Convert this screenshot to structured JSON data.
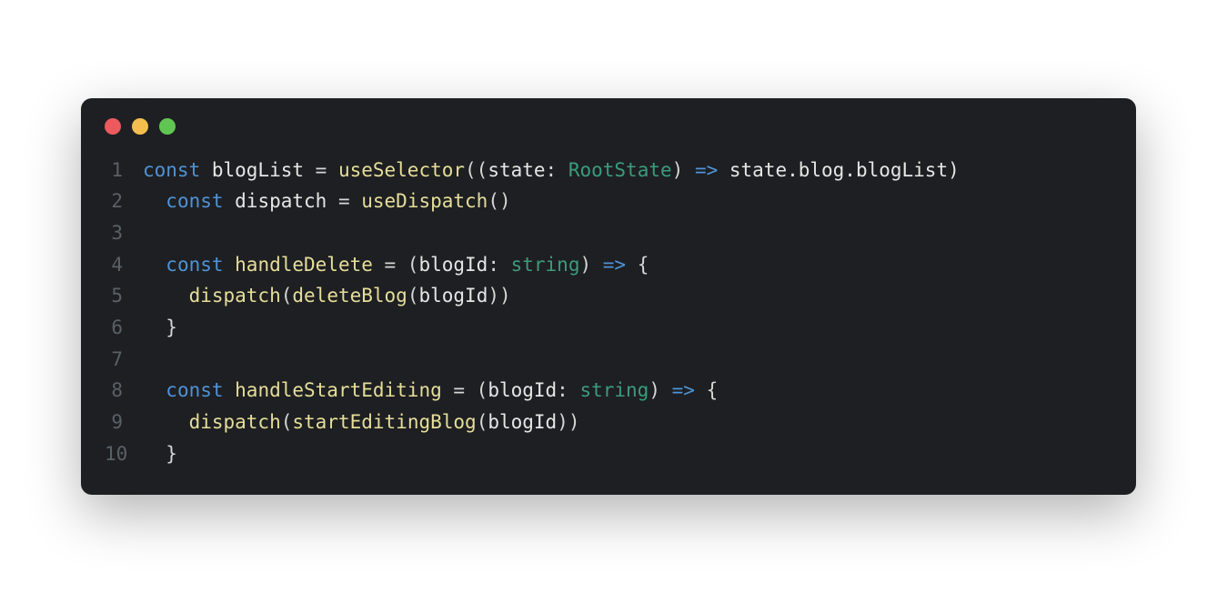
{
  "window": {
    "traffic_lights": {
      "close_color": "#ec5a5e",
      "min_color": "#f4be4f",
      "max_color": "#61c554"
    }
  },
  "colors": {
    "bg": "#1e1f22",
    "keyword": "#4f93d6",
    "function": "#e5de9a",
    "type": "#3a9c7b",
    "text": "#d8dde3",
    "gutter": "#5a6068"
  },
  "code": {
    "line_numbers": [
      "1",
      "2",
      "3",
      "4",
      "5",
      "6",
      "7",
      "8",
      "9",
      "10"
    ],
    "lines": [
      [
        {
          "t": "const ",
          "c": "kw"
        },
        {
          "t": "blogList",
          "c": "var"
        },
        {
          "t": " = ",
          "c": "punc"
        },
        {
          "t": "useSelector",
          "c": "fn"
        },
        {
          "t": "((",
          "c": "punc"
        },
        {
          "t": "state",
          "c": "var"
        },
        {
          "t": ": ",
          "c": "punc"
        },
        {
          "t": "RootState",
          "c": "type"
        },
        {
          "t": ") ",
          "c": "punc"
        },
        {
          "t": "=>",
          "c": "op"
        },
        {
          "t": " state.blog.blogList)",
          "c": "var"
        }
      ],
      [
        {
          "t": "  ",
          "c": "punc"
        },
        {
          "t": "const ",
          "c": "kw"
        },
        {
          "t": "dispatch",
          "c": "var"
        },
        {
          "t": " = ",
          "c": "punc"
        },
        {
          "t": "useDispatch",
          "c": "fn"
        },
        {
          "t": "()",
          "c": "punc"
        }
      ],
      [
        {
          "t": "",
          "c": "punc"
        }
      ],
      [
        {
          "t": "  ",
          "c": "punc"
        },
        {
          "t": "const ",
          "c": "kw"
        },
        {
          "t": "handleDelete",
          "c": "fn"
        },
        {
          "t": " = (",
          "c": "punc"
        },
        {
          "t": "blogId",
          "c": "var"
        },
        {
          "t": ": ",
          "c": "punc"
        },
        {
          "t": "string",
          "c": "str"
        },
        {
          "t": ") ",
          "c": "punc"
        },
        {
          "t": "=>",
          "c": "op"
        },
        {
          "t": " {",
          "c": "punc"
        }
      ],
      [
        {
          "t": "    ",
          "c": "punc"
        },
        {
          "t": "dispatch",
          "c": "fn"
        },
        {
          "t": "(",
          "c": "punc"
        },
        {
          "t": "deleteBlog",
          "c": "fn"
        },
        {
          "t": "(",
          "c": "punc"
        },
        {
          "t": "blogId",
          "c": "var"
        },
        {
          "t": "))",
          "c": "punc"
        }
      ],
      [
        {
          "t": "  }",
          "c": "punc"
        }
      ],
      [
        {
          "t": "",
          "c": "punc"
        }
      ],
      [
        {
          "t": "  ",
          "c": "punc"
        },
        {
          "t": "const ",
          "c": "kw"
        },
        {
          "t": "handleStartEditing",
          "c": "fn"
        },
        {
          "t": " = (",
          "c": "punc"
        },
        {
          "t": "blogId",
          "c": "var"
        },
        {
          "t": ": ",
          "c": "punc"
        },
        {
          "t": "string",
          "c": "str"
        },
        {
          "t": ") ",
          "c": "punc"
        },
        {
          "t": "=>",
          "c": "op"
        },
        {
          "t": " {",
          "c": "punc"
        }
      ],
      [
        {
          "t": "    ",
          "c": "punc"
        },
        {
          "t": "dispatch",
          "c": "fn"
        },
        {
          "t": "(",
          "c": "punc"
        },
        {
          "t": "startEditingBlog",
          "c": "fn"
        },
        {
          "t": "(",
          "c": "punc"
        },
        {
          "t": "blogId",
          "c": "var"
        },
        {
          "t": "))",
          "c": "punc"
        }
      ],
      [
        {
          "t": "  }",
          "c": "punc"
        }
      ]
    ]
  }
}
